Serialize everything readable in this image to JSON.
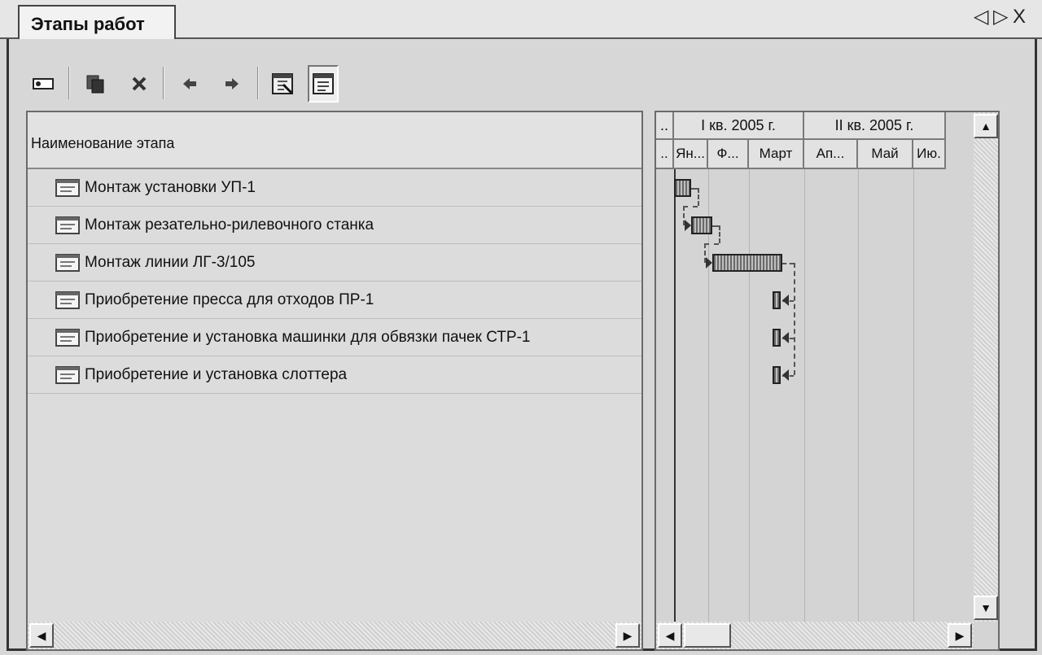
{
  "window": {
    "tab_title": "Этапы работ",
    "controls": {
      "prev": "◁",
      "next": "▷",
      "close": "X"
    }
  },
  "toolbar": {
    "buttons": [
      {
        "name": "new-stage-button",
        "icon": "new-item-icon"
      },
      {
        "name": "copy-button",
        "icon": "copy-icon"
      },
      {
        "name": "delete-button",
        "icon": "delete-icon"
      },
      {
        "name": "move-left-button",
        "icon": "arrow-left-icon"
      },
      {
        "name": "move-right-button",
        "icon": "arrow-right-icon"
      },
      {
        "name": "edit-view-button",
        "icon": "edit-window-icon"
      },
      {
        "name": "gantt-view-button",
        "icon": "list-window-icon"
      }
    ]
  },
  "stages_table": {
    "column_header": "Наименование этапа",
    "rows": [
      {
        "name": "Монтаж установки УП-1"
      },
      {
        "name": "Монтаж резательно-рилевочного станка"
      },
      {
        "name": "Монтаж  линии ЛГ-3/105"
      },
      {
        "name": "Приобретение пресса для отходов ПР-1"
      },
      {
        "name": "Приобретение и установка машинки для обвязки пачек СТР-1"
      },
      {
        "name": "Приобретение и установка слоттера"
      }
    ]
  },
  "gantt": {
    "quarters": [
      {
        "label": "..",
        "span": 1
      },
      {
        "label": "I кв. 2005 г.",
        "span": 3
      },
      {
        "label": "II кв. 2005 г.",
        "span": 3
      }
    ],
    "months": [
      "..",
      "Ян...",
      "Ф...",
      "Март",
      "Ап...",
      "Май",
      "Ию."
    ],
    "tasks": [
      {
        "start": 0.0,
        "end": 0.5
      },
      {
        "start": 0.5,
        "end": 1.1
      },
      {
        "start": 1.1,
        "end": 2.6
      },
      {
        "start": 2.42,
        "end": 2.58
      },
      {
        "start": 2.42,
        "end": 2.58
      },
      {
        "start": 2.42,
        "end": 2.58
      }
    ]
  }
}
